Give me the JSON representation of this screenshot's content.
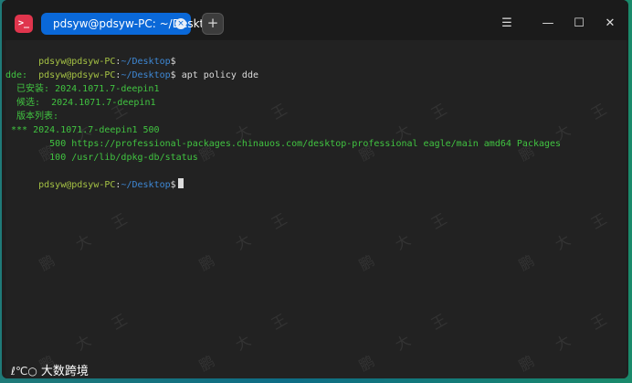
{
  "window": {
    "tab_title": "pdsyw@pdsyw-PC: ~/Desktop",
    "new_tab_label": "+",
    "min_label": "—",
    "max_label": "☐",
    "close_label": "✕",
    "tab_close_label": "×"
  },
  "prompt": {
    "user": "pdsyw@pdsyw-PC",
    "colon": ":",
    "path": "~/Desktop",
    "dollar": "$"
  },
  "terminal": {
    "command1": "",
    "command2": " apt policy dde",
    "out_lines": [
      "dde:",
      "  已安装: 2024.1071.7-deepin1",
      "  候选:  2024.1071.7-deepin1",
      "  版本列表:",
      " *** 2024.1071.7-deepin1 500",
      "        500 https://professional-packages.chinauos.com/desktop-professional eagle/main amd64 Packages",
      "        100 /usr/lib/dpkg-db/status"
    ],
    "command3": ""
  },
  "watermark_text": "鹏 大 王",
  "branding": {
    "mark": "ℓ℃○",
    "text": "大数跨境"
  },
  "colors": {
    "tab_active": "#0a68d8",
    "prompt_user": "#a5c244",
    "prompt_path": "#3e88d5",
    "output_green": "#41c441",
    "app_icon": "#e0354d"
  }
}
